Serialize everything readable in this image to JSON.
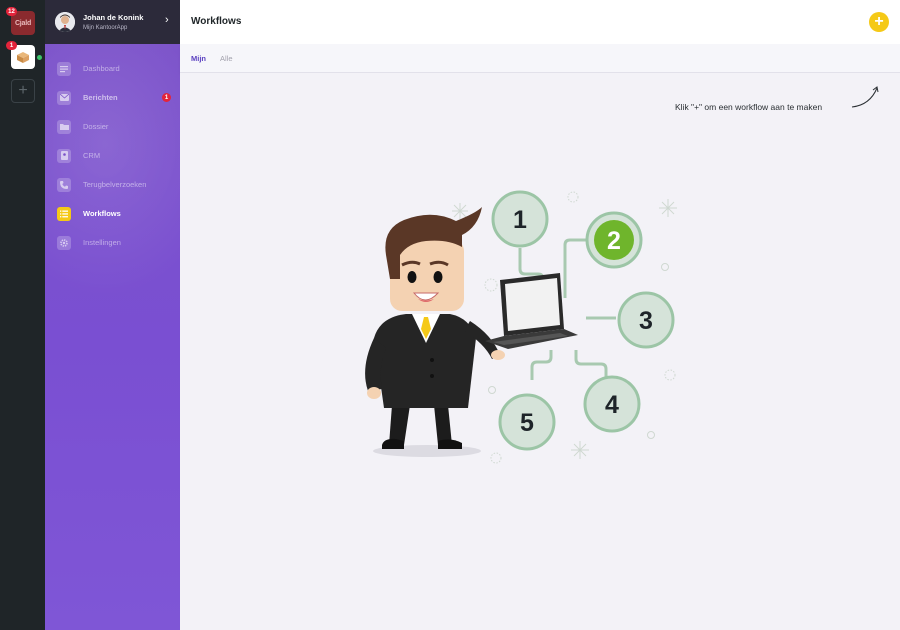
{
  "apps": [
    {
      "name": "Cjald",
      "badge": "12"
    },
    {
      "name": "Mijn KantoorApp",
      "badge": "1"
    }
  ],
  "user": {
    "name": "Johan de Konink",
    "subtitle": "Mijn KantoorApp"
  },
  "nav": [
    {
      "label": "Dashboard",
      "icon": "dashboard-icon",
      "active": false
    },
    {
      "label": "Berichten",
      "icon": "messages-icon",
      "active": false,
      "badge": "1"
    },
    {
      "label": "Dossier",
      "icon": "folder-icon",
      "active": false
    },
    {
      "label": "CRM",
      "icon": "contacts-icon",
      "active": false
    },
    {
      "label": "Terugbelverzoeken",
      "icon": "phone-icon",
      "active": false
    },
    {
      "label": "Workflows",
      "icon": "list-icon",
      "active": true
    },
    {
      "label": "Instellingen",
      "icon": "gear-icon",
      "active": false
    }
  ],
  "header": {
    "title": "Workflows",
    "add_label": "+"
  },
  "tabs": [
    {
      "label": "Mijn",
      "active": true
    },
    {
      "label": "Alle",
      "active": false
    }
  ],
  "empty_state": {
    "hint": "Klik \"+\" om een workflow aan te maken",
    "steps": [
      "1",
      "2",
      "3",
      "4",
      "5"
    ]
  },
  "colors": {
    "accent": "#f5c917",
    "sidebar": "#7b52c8",
    "badge": "#e3243b",
    "highlight_step": "#6fb52c",
    "tab_active": "#5a3fc0"
  }
}
